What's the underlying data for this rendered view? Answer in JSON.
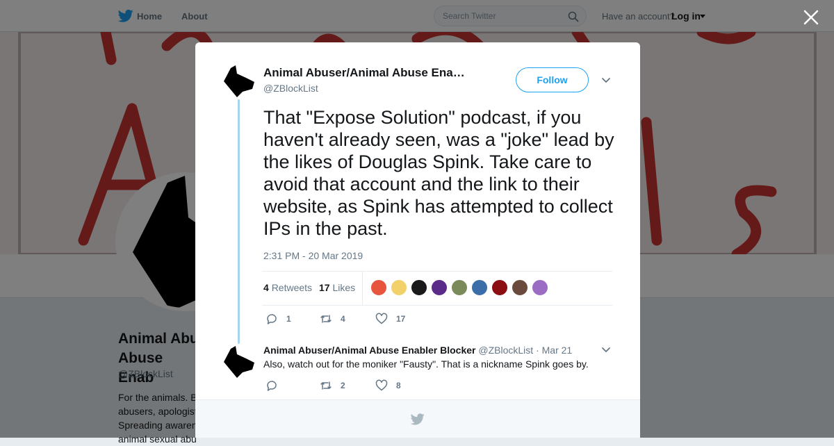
{
  "nav": {
    "home_label": "Home",
    "about_label": "About",
    "search_placeholder": "Search Twitter",
    "account_prompt": "Have an account?",
    "login_label": "Log in"
  },
  "profile": {
    "name_line1": "Animal Abu",
    "name_line2": "Abuse Enab",
    "handle": "@ZBlockList",
    "bio_lines": [
      "For the animals. B",
      "abusers, apologist",
      "Spreading awaren",
      "animal sexual abu"
    ]
  },
  "tweet": {
    "display_name": "Animal Abuser/Animal Abuse Ena…",
    "handle": "@ZBlockList",
    "follow_label": "Follow",
    "text": "That \"Expose Solution\" podcast, if you haven't already seen, was a \"joke\" lead by the likes of Douglas Spink. Take care to avoid that account and the link to their website, as Spink has attempted to collect IPs in the past.",
    "timestamp": "2:31 PM - 20 Mar 2019",
    "retweets_count": "4",
    "retweets_label": "Retweets",
    "likes_count": "17",
    "likes_label": "Likes",
    "likers_avatars": [
      "#e8553e",
      "#f2d16b",
      "#1a1a1a",
      "#5b2b8a",
      "#7a8a5a",
      "#3b6ea8",
      "#8a0e12",
      "#6b4a3e",
      "#9b6cc4"
    ],
    "reply_count": "1",
    "retweet_count": "4",
    "like_count": "17"
  },
  "reply": {
    "display_name": "Animal Abuser/Animal Abuse Enabler Blocker",
    "handle": "@ZBlockList",
    "date": "· Mar 21",
    "text": "Also, watch out for the moniker \"Fausty\". That is a nickname Spink goes by.",
    "reply_count": "",
    "retweet_count": "2",
    "like_count": "8"
  },
  "colors": {
    "accent": "#1da1f2",
    "thread_line": "#a8d4f0",
    "banner_letters": "#c73432"
  }
}
